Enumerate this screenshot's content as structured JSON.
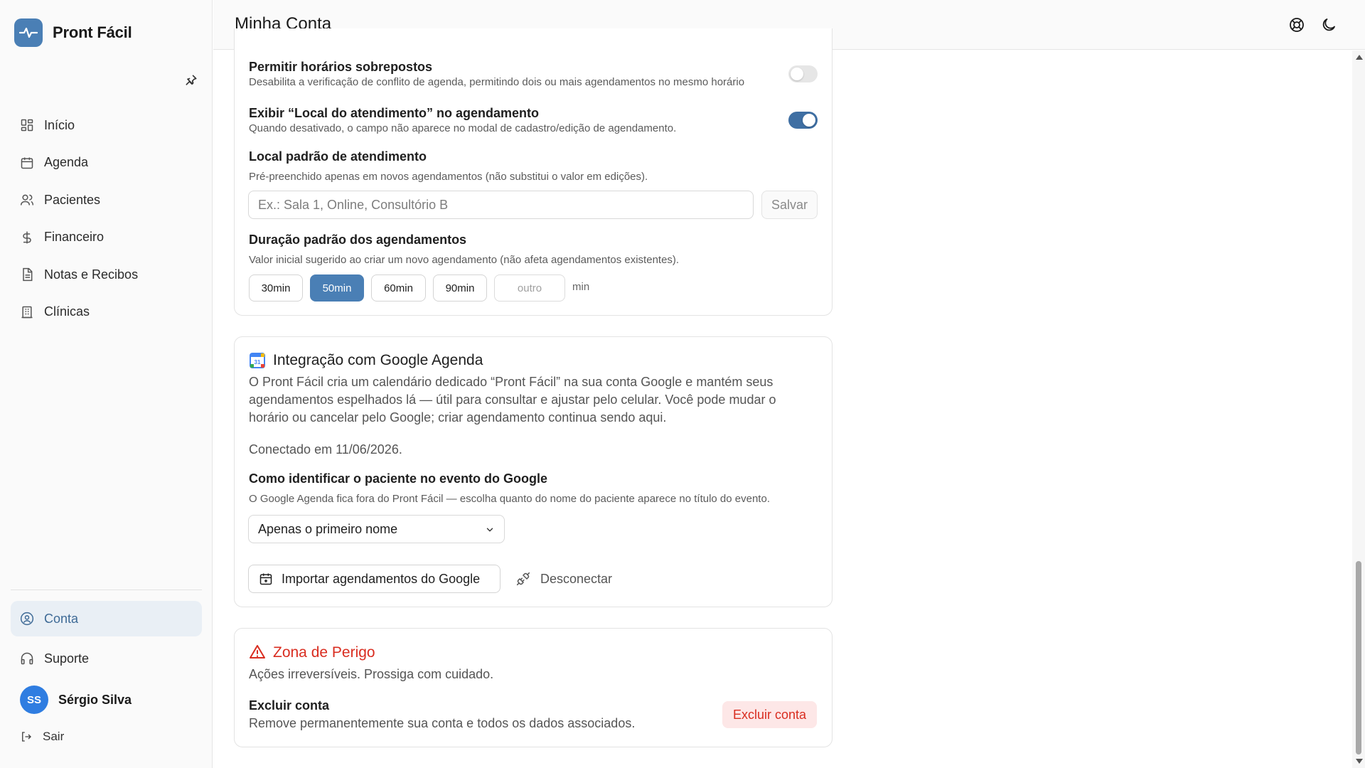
{
  "app": {
    "name": "Pront Fácil"
  },
  "header": {
    "title": "Minha Conta"
  },
  "sidebar": {
    "items": [
      {
        "label": "Início",
        "icon": "grid-icon"
      },
      {
        "label": "Agenda",
        "icon": "calendar-icon"
      },
      {
        "label": "Pacientes",
        "icon": "users-icon"
      },
      {
        "label": "Financeiro",
        "icon": "dollar-icon"
      },
      {
        "label": "Notas e Recibos",
        "icon": "document-icon"
      },
      {
        "label": "Clínicas",
        "icon": "building-icon"
      }
    ],
    "account": "Conta",
    "support": "Suporte",
    "user": {
      "initials": "SS",
      "name": "Sérgio Silva"
    },
    "logout": "Sair"
  },
  "schedule": {
    "overlap": {
      "title": "Permitir horários sobrepostos",
      "help": "Desabilita a verificação de conflito de agenda, permitindo dois ou mais agendamentos no mesmo horário",
      "enabled": false
    },
    "show_location": {
      "title": "Exibir “Local do atendimento” no agendamento",
      "help": "Quando desativado, o campo não aparece no modal de cadastro/edição de agendamento.",
      "enabled": true
    },
    "default_location": {
      "title": "Local padrão de atendimento",
      "help": "Pré-preenchido apenas em novos agendamentos (não substitui o valor em edições).",
      "placeholder": "Ex.: Sala 1, Online, Consultório B",
      "value": "",
      "save_label": "Salvar"
    },
    "default_duration": {
      "title": "Duração padrão dos agendamentos",
      "help": "Valor inicial sugerido ao criar um novo agendamento (não afeta agendamentos existentes).",
      "options": [
        "30min",
        "50min",
        "60min",
        "90min"
      ],
      "selected": "50min",
      "other_placeholder": "outro",
      "unit": "min"
    }
  },
  "google": {
    "title": "Integração com Google Agenda",
    "description_lines": [
      "O Pront Fácil cria um calendário dedicado “Pront Fácil” na sua conta Google e mantém seus",
      "agendamentos espelhados lá — útil para consultar e ajustar pelo celular. Você pode mudar o",
      "horário ou cancelar pelo Google; criar agendamento continua sendo aqui."
    ],
    "connected": "Conectado em 11/06/2026.",
    "identify": {
      "title": "Como identificar o paciente no evento do Google",
      "help": "O Google Agenda fica fora do Pront Fácil — escolha quanto do nome do paciente aparece no título do evento.",
      "selected": "Apenas o primeiro nome"
    },
    "import_label": "Importar agendamentos do Google",
    "disconnect_label": "Desconectar"
  },
  "danger": {
    "title": "Zona de Perigo",
    "subtitle": "Ações irreversíveis. Prossiga com cuidado.",
    "delete": {
      "title": "Excluir conta",
      "help": "Remove permanentemente sua conta e todos os dados associados.",
      "button": "Excluir conta"
    }
  },
  "colors": {
    "brand": "#4a7fb5",
    "toggle_on": "#3f6fa3",
    "danger": "#d92d20",
    "active_nav_bg": "#e9eff5"
  }
}
